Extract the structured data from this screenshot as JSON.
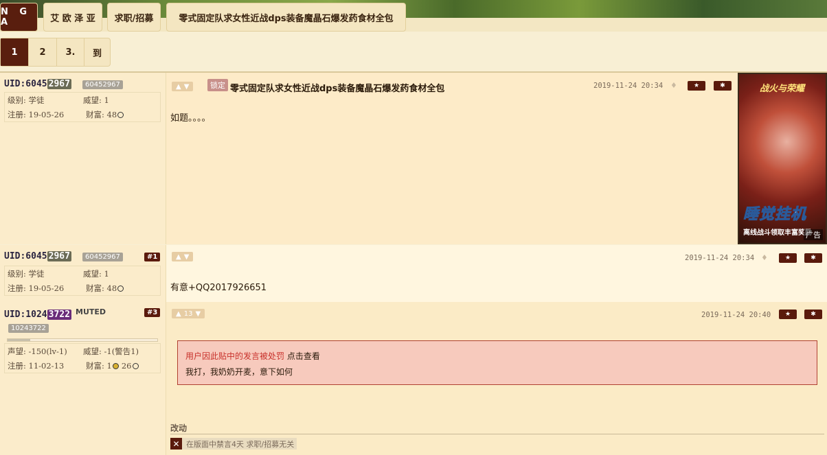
{
  "breadcrumbs": [
    {
      "label": "N G A"
    },
    {
      "label": "艾 欧 泽 亚"
    },
    {
      "label": "求职/招募"
    },
    {
      "label": "零式固定队求女性近战dps装备魔晶石爆发药食材全包"
    }
  ],
  "pagination": [
    {
      "label": "1",
      "active": true
    },
    {
      "label": "2"
    },
    {
      "label": "3."
    },
    {
      "label": "到"
    }
  ],
  "posts": [
    {
      "uid_prefix": "UID:6045",
      "uid_highlight": "2967",
      "uid_tag": "60452967",
      "info": {
        "k1": "级别: 学徒",
        "k2": "威望: 1",
        "k3": "注册: 19-05-26",
        "k4": "财富: 48"
      },
      "locked_label": "锁定",
      "title": "零式固定队求女性近战dps装备魔晶石爆发药食材全包",
      "time": "2019-11-24 20:34",
      "content": "如题。。。。"
    },
    {
      "uid_prefix": "UID:6045",
      "uid_highlight": "2967",
      "uid_tag": "60452967",
      "floor": "#1",
      "info": {
        "k1": "级别: 学徒",
        "k2": "威望: 1",
        "k3": "注册: 19-05-26",
        "k4": "财富: 48"
      },
      "time": "2019-11-24 20:34",
      "content": "有意+QQ2017926651"
    },
    {
      "uid_prefix": "UID:1024",
      "uid_highlight": "3722",
      "uid_tag": "10243722",
      "muted": "MUTED",
      "floor": "#3",
      "reputation_fraction": 0.15,
      "info": {
        "k1": "声望: -150(lv-1)",
        "k2": "威望: -1(警告1)",
        "k3": "注册: 11-02-13",
        "k4a": "财富: 1",
        "k4b": "26"
      },
      "votes": "13",
      "time": "2019-11-24 20:40",
      "penalty_text": "用户因此贴中的发言被处罚",
      "penalty_link": "点击查看",
      "content": "我打，我奶奶开麦，意下如何",
      "edit_title": "改动",
      "edit_log": "在版面中禁言4天 求职/招募无关"
    }
  ],
  "ad": {
    "title": "战火与荣耀",
    "big_text": "睡觉挂机",
    "sub_text": "离线战斗领取丰富奖励",
    "label": "广告"
  },
  "colors": {
    "accent": "#591e0e",
    "background": "#f8efd4"
  }
}
